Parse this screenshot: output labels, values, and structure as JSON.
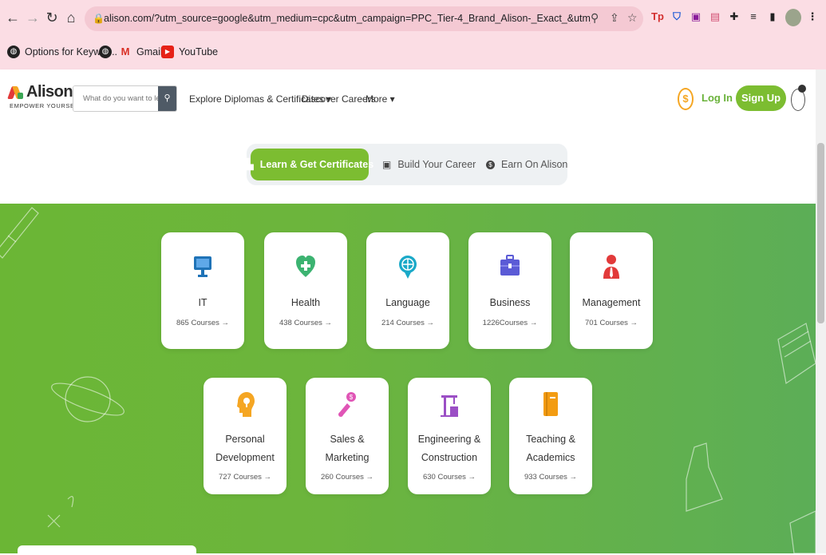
{
  "browser": {
    "url": "alison.com/?utm_source=google&utm_medium=cpc&utm_campaign=PPC_Tier-4_Brand_Alison-_Exact_&utm_adgroup=Brand...",
    "bookmarks": [
      {
        "label": "Options for Keywor...",
        "icon": "globe-icon"
      },
      {
        "label": "",
        "icon": "globe-icon"
      },
      {
        "label": "Gmail",
        "icon": "gmail-icon"
      },
      {
        "label": "YouTube",
        "icon": "youtube-icon"
      }
    ],
    "extensions": [
      "Tp",
      "shield",
      "notion",
      "translate",
      "puzzle",
      "queue",
      "sidepanel",
      "profile"
    ]
  },
  "header": {
    "logo_word": "Alison",
    "logo_tagline": "EMPOWER YOURSELF",
    "search_placeholder": "What do you want to learn?",
    "nav": {
      "explore": "Explore Diplomas & Certificates ▾",
      "careers": "Discover Careers",
      "more": "More ▾"
    },
    "coin_symbol": "$",
    "login": "Log In",
    "signup": "Sign Up"
  },
  "tabs": [
    {
      "label": "Learn & Get Certificates",
      "active": true
    },
    {
      "label": "Build Your Career",
      "active": false
    },
    {
      "label": "Earn On Alison",
      "active": false
    }
  ],
  "categories": [
    {
      "name_lines": [
        "IT"
      ],
      "count": "865 Courses →",
      "color": "#1f73b7"
    },
    {
      "name_lines": [
        "Health"
      ],
      "count": "438 Courses →",
      "color": "#3cb371"
    },
    {
      "name_lines": [
        "Language"
      ],
      "count": "214 Courses →",
      "color": "#1aa9c8"
    },
    {
      "name_lines": [
        "Business"
      ],
      "count": "1226Courses →",
      "color": "#5b5bd6"
    },
    {
      "name_lines": [
        "Management"
      ],
      "count": "701 Courses →",
      "color": "#e23a3a"
    },
    {
      "name_lines": [
        "Personal",
        "Development"
      ],
      "count": "727 Courses →",
      "color": "#f5a623"
    },
    {
      "name_lines": [
        "Sales &",
        "Marketing"
      ],
      "count": "260 Courses →",
      "color": "#e055b6"
    },
    {
      "name_lines": [
        "Engineering &",
        "Construction"
      ],
      "count": "630 Courses →",
      "color": "#9b4fc5"
    },
    {
      "name_lines": [
        "Teaching &",
        "Academics"
      ],
      "count": "933 Courses →",
      "color": "#f39c12"
    }
  ],
  "colors": {
    "brand_green": "#7cbd31",
    "hero_green": "#6bb635",
    "chrome_pink": "#fbdde4"
  }
}
